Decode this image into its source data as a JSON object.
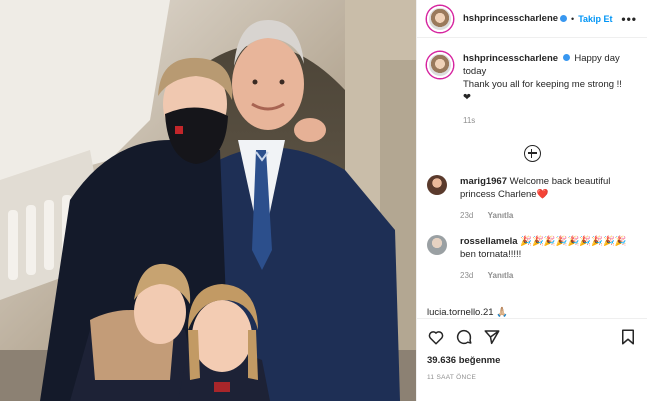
{
  "header": {
    "username": "hshprincesscharlene",
    "dot": "•",
    "follow_label": "Takip Et",
    "more_icon": "more-options-icon"
  },
  "caption": {
    "username": "hshprincesscharlene",
    "text_line1": "Happy day today",
    "text_line2": "Thank you all for keeping me strong !!",
    "heart": "❤",
    "time": "11s"
  },
  "comments": [
    {
      "username": "marig1967",
      "text": "Welcome back beautiful princess Charlene",
      "emoji": "❤️",
      "time": "23d",
      "reply_label": "Yanıtla",
      "avatar_color": "#5a3a2c"
    },
    {
      "username": "rossellamela",
      "text": "🎉🎉🎉🎉🎉🎉🎉🎉🎉ben tornata!!!!!",
      "time": "23d",
      "reply_label": "Yanıtla",
      "avatar_color": "#9aa0a3"
    }
  ],
  "cutoff_comment": "lucia.tornello.21 🙏🏼",
  "actions": {
    "like_icon": "heart-icon",
    "comment_icon": "comment-icon",
    "share_icon": "share-icon",
    "save_icon": "bookmark-icon"
  },
  "likes": "39.636 beğenme",
  "time_ago": "11 SAAT ÖNCE",
  "colors": {
    "accent": "#0095f6",
    "verified": "#3897f0",
    "muted": "#8e8e8e",
    "text": "#262626"
  }
}
